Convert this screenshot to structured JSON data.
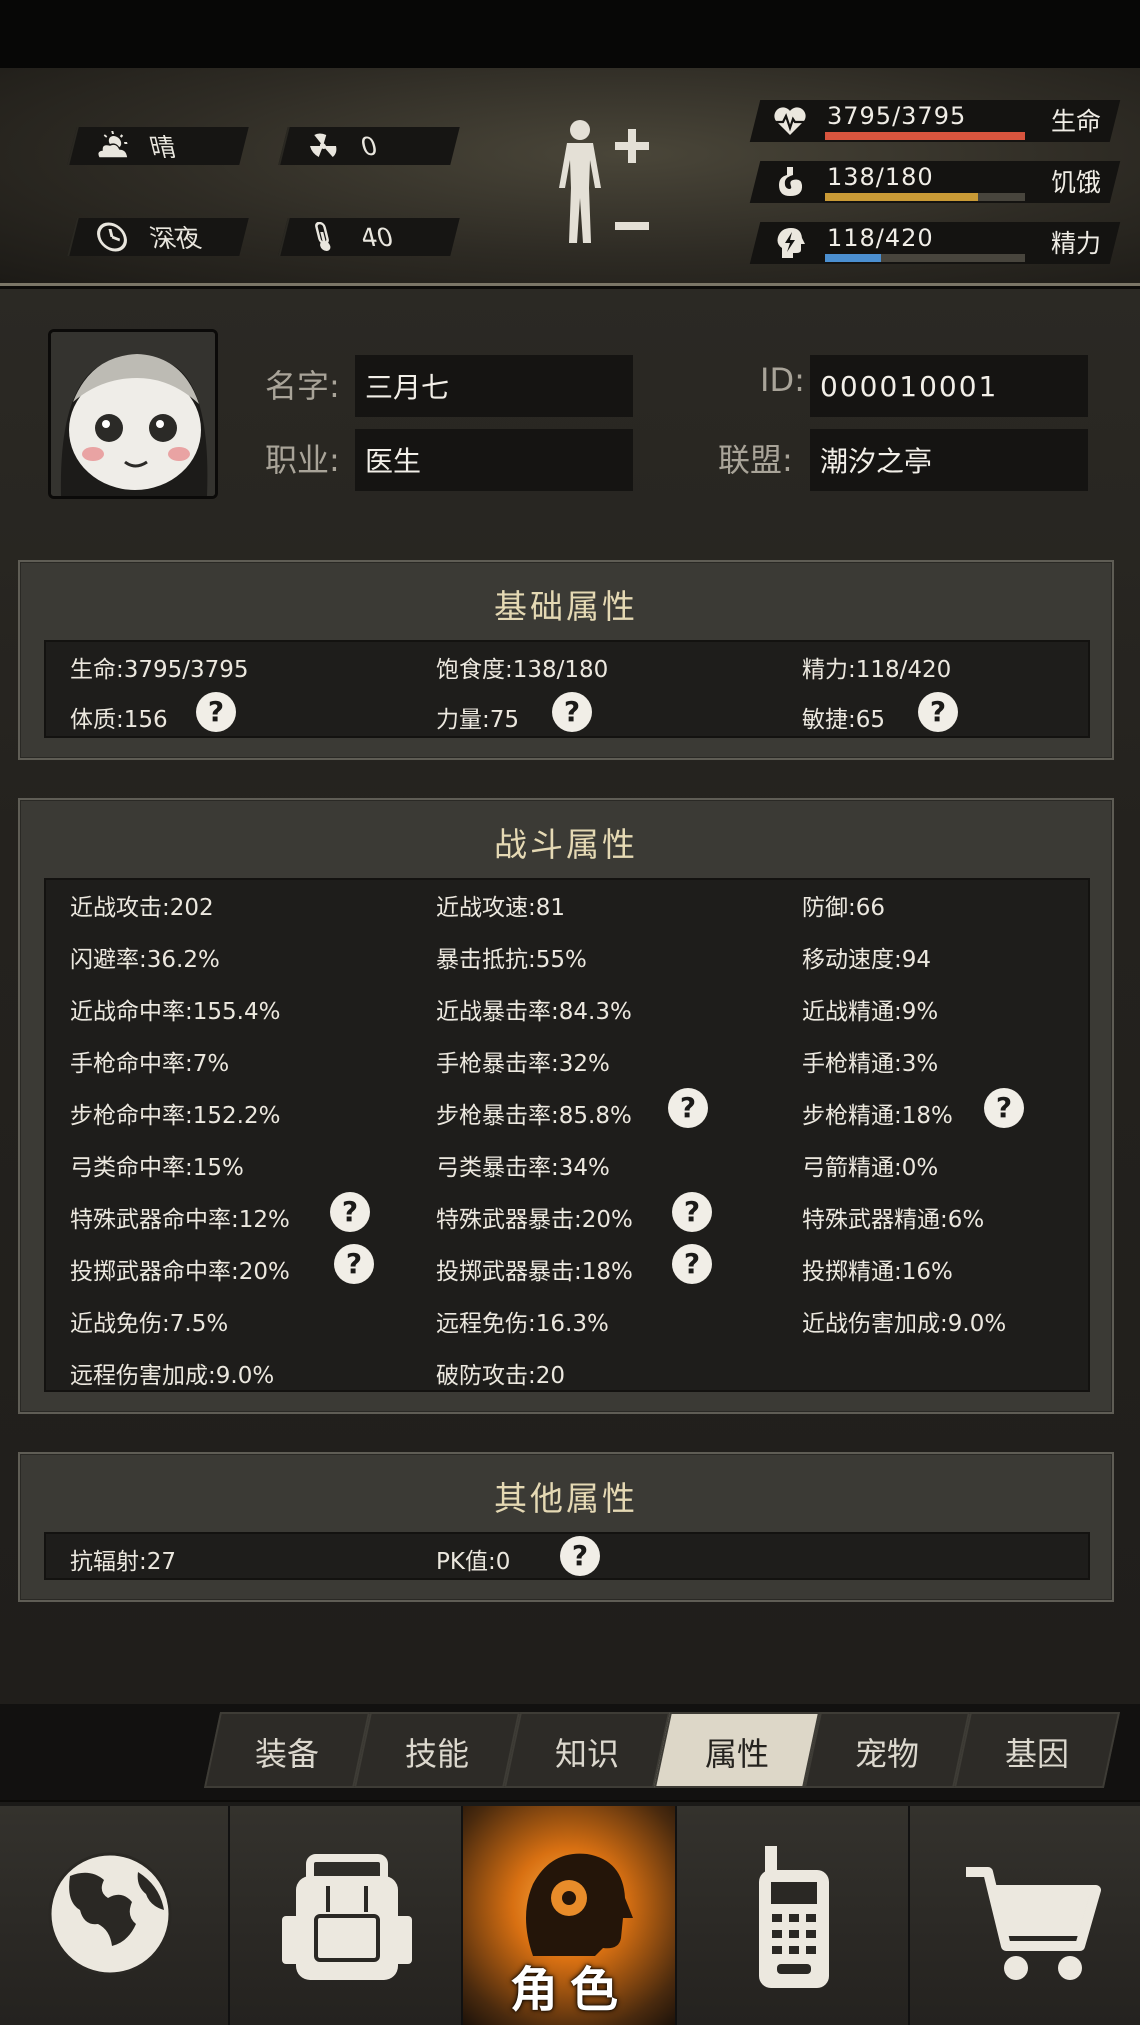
{
  "hud": {
    "weather": "晴",
    "radiation": "0",
    "time_of_day": "深夜",
    "temperature": "40"
  },
  "vitals": [
    {
      "key": "life",
      "value": "3795/3795",
      "label": "生命",
      "fraction": 1.0,
      "color": "#d8553e",
      "icon": "heart-pulse-icon"
    },
    {
      "key": "hunger",
      "value": "138/180",
      "label": "饥饿",
      "fraction": 0.767,
      "color": "#c99a36",
      "icon": "stomach-icon"
    },
    {
      "key": "energy",
      "value": "118/420",
      "label": "精力",
      "fraction": 0.281,
      "color": "#4b8fd0",
      "icon": "lightning-head-icon"
    }
  ],
  "profile": {
    "name_label": "名字:",
    "name": "三月七",
    "id_label": "ID:",
    "id": "000010001",
    "job_label": "职业:",
    "job": "医生",
    "alliance_label": "联盟:",
    "alliance": "潮汐之亭"
  },
  "basic": {
    "title": "基础属性",
    "rows": [
      [
        "生命:3795/3795",
        "饱食度:138/180",
        "精力:118/420"
      ],
      [
        "体质:156",
        "力量:75",
        "敏捷:65"
      ]
    ]
  },
  "combat": {
    "title": "战斗属性",
    "rows": [
      [
        "近战攻击:202",
        "近战攻速:81",
        "防御:66"
      ],
      [
        "闪避率:36.2%",
        "暴击抵抗:55%",
        "移动速度:94"
      ],
      [
        "近战命中率:155.4%",
        "近战暴击率:84.3%",
        "近战精通:9%"
      ],
      [
        "手枪命中率:7%",
        "手枪暴击率:32%",
        "手枪精通:3%"
      ],
      [
        "步枪命中率:152.2%",
        "步枪暴击率:85.8%",
        "步枪精通:18%"
      ],
      [
        "弓类命中率:15%",
        "弓类暴击率:34%",
        "弓箭精通:0%"
      ],
      [
        "特殊武器命中率:12%",
        "特殊武器暴击:20%",
        "特殊武器精通:6%"
      ],
      [
        "投掷武器命中率:20%",
        "投掷武器暴击:18%",
        "投掷精通:16%"
      ],
      [
        "近战免伤:7.5%",
        "远程免伤:16.3%",
        "近战伤害加成:9.0%"
      ],
      [
        "远程伤害加成:9.0%",
        "破防攻击:20",
        ""
      ]
    ]
  },
  "other": {
    "title": "其他属性",
    "rows": [
      [
        "抗辐射:27",
        "PK值:0",
        ""
      ]
    ]
  },
  "help_glyph": "?",
  "tabs": [
    "装备",
    "技能",
    "知识",
    "属性",
    "宠物",
    "基因"
  ],
  "active_tab": "属性",
  "nav": {
    "active_label": "角色",
    "items": [
      "globe-icon",
      "backpack-icon",
      "character-icon",
      "radio-icon",
      "cart-icon"
    ]
  }
}
